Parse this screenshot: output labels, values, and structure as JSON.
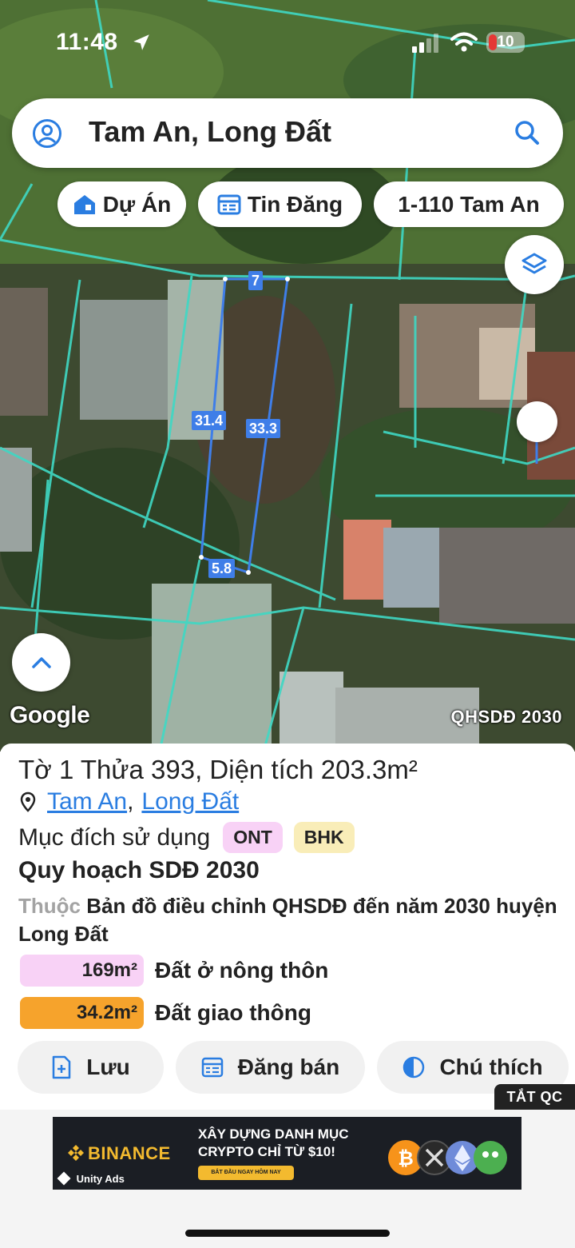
{
  "status_bar": {
    "time": "11:48",
    "battery": "10"
  },
  "search": {
    "query": "Tam An, Long Đất"
  },
  "chips": {
    "project": "Dự Án",
    "listings": "Tin Đăng",
    "address": "1-110 Tam An"
  },
  "map": {
    "dimensions": {
      "top": "7",
      "left": "31.4",
      "right": "33.3",
      "bottom": "5.8"
    },
    "attribution": "Google",
    "layer_label": "QHSDĐ 2030"
  },
  "parcel": {
    "title": "Tờ 1 Thửa 393, Diện tích 203.3m²",
    "ward": "Tam An",
    "separator": ",",
    "district": "Long Đất",
    "purpose_label": "Mục đích sử dụng",
    "purpose_tags": [
      {
        "code": "ONT",
        "color": "#f8d2f6"
      },
      {
        "code": "BHK",
        "color": "#f9edb8"
      }
    ],
    "plan_title": "Quy hoạch SDĐ 2030",
    "belong_prefix": "Thuộc",
    "belong_text": "Bản đồ điều chỉnh QHSDĐ đến năm 2030 huyện Long Đất",
    "land_use": [
      {
        "area": "169m²",
        "label": "Đất ở nông thôn",
        "color": "#f8d2f6"
      },
      {
        "area": "34.2m²",
        "label": "Đất giao thông",
        "color": "#f6a32c"
      }
    ]
  },
  "actions": {
    "save": "Lưu",
    "post": "Đăng bán",
    "legend": "Chú thích",
    "ads_off": "TẮT QC"
  },
  "ad": {
    "brand": "BINANCE",
    "headline_1": "XÂY DỰNG DANH MỤC",
    "headline_2": "CRYPTO CHỈ TỪ $10!",
    "cta": "BẮT ĐẦU NGAY HÔM NAY",
    "network": "Unity Ads"
  },
  "colors": {
    "accent": "#2a7de1",
    "parcel_line": "#3f7ee8",
    "cadastral_line": "#3fd8c4"
  }
}
